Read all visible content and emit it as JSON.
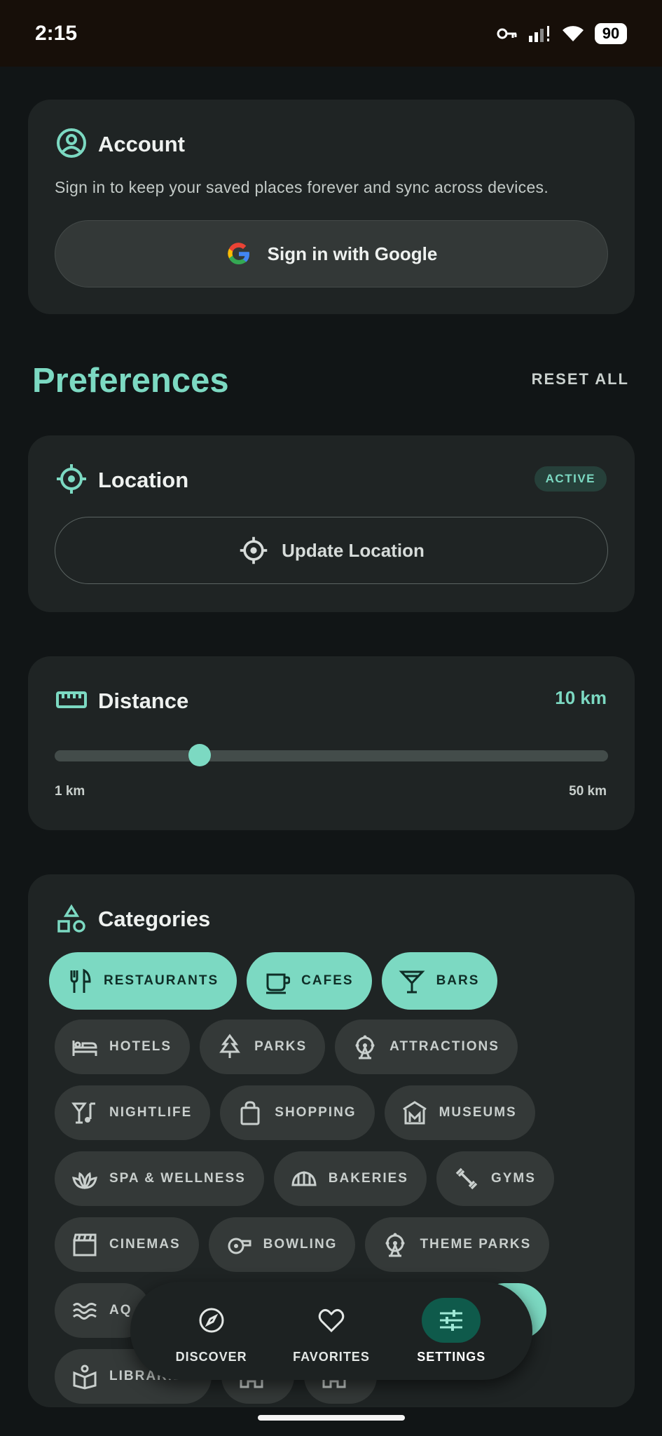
{
  "status_bar": {
    "time": "2:15",
    "battery": "90"
  },
  "account": {
    "title": "Account",
    "description": "Sign in to keep your saved places forever and sync across devices.",
    "google_button": "Sign in with Google"
  },
  "preferences": {
    "title": "Preferences",
    "reset_all": "RESET ALL"
  },
  "location": {
    "title": "Location",
    "status": "ACTIVE",
    "update_button": "Update Location"
  },
  "distance": {
    "title": "Distance",
    "value_label": "10 km",
    "min_label": "1 km",
    "max_label": "50 km",
    "value": 10,
    "min": 1,
    "max": 50
  },
  "categories": {
    "title": "Categories",
    "rows": [
      [
        {
          "label": "RESTAURANTS",
          "icon": "cutlery-icon",
          "selected": true
        },
        {
          "label": "CAFES",
          "icon": "coffee-cup-icon",
          "selected": true
        },
        {
          "label": "BARS",
          "icon": "cocktail-icon",
          "selected": true
        }
      ],
      [
        {
          "label": "HOTELS",
          "icon": "bed-icon",
          "selected": false
        },
        {
          "label": "PARKS",
          "icon": "tree-icon",
          "selected": false
        },
        {
          "label": "ATTRACTIONS",
          "icon": "ferris-wheel-icon",
          "selected": false
        }
      ],
      [
        {
          "label": "NIGHTLIFE",
          "icon": "nightlife-icon",
          "selected": false
        },
        {
          "label": "SHOPPING",
          "icon": "shopping-bag-icon",
          "selected": false
        },
        {
          "label": "MUSEUMS",
          "icon": "museum-icon",
          "selected": false
        }
      ],
      [
        {
          "label": "SPA & WELLNESS",
          "icon": "lotus-icon",
          "selected": false
        },
        {
          "label": "BAKERIES",
          "icon": "croissant-icon",
          "selected": false
        },
        {
          "label": "GYMS",
          "icon": "dumbbell-icon",
          "selected": false
        }
      ],
      [
        {
          "label": "CINEMAS",
          "icon": "clapperboard-icon",
          "selected": false
        },
        {
          "label": "BOWLING",
          "icon": "bowling-icon",
          "selected": false
        },
        {
          "label": "THEME PARKS",
          "icon": "ferris-wheel-icon",
          "selected": false
        }
      ],
      [
        {
          "label": "AQ",
          "icon": "waves-icon",
          "selected": false
        }
      ],
      [
        {
          "label": "LIBRARIES",
          "icon": "book-icon",
          "selected": false
        },
        {
          "label": "",
          "icon": "stadium-icon",
          "selected": false
        },
        {
          "label": "",
          "icon": "church-icon",
          "selected": false
        }
      ]
    ]
  },
  "bottom_nav": {
    "items": [
      {
        "label": "DISCOVER",
        "icon": "compass-icon",
        "active": false
      },
      {
        "label": "FAVORITES",
        "icon": "heart-icon",
        "active": false
      },
      {
        "label": "SETTINGS",
        "icon": "sliders-icon",
        "active": true
      }
    ]
  },
  "colors": {
    "accent": "#7cd9c2",
    "background": "#111516",
    "card": "#1f2424",
    "chip": "#343938"
  }
}
